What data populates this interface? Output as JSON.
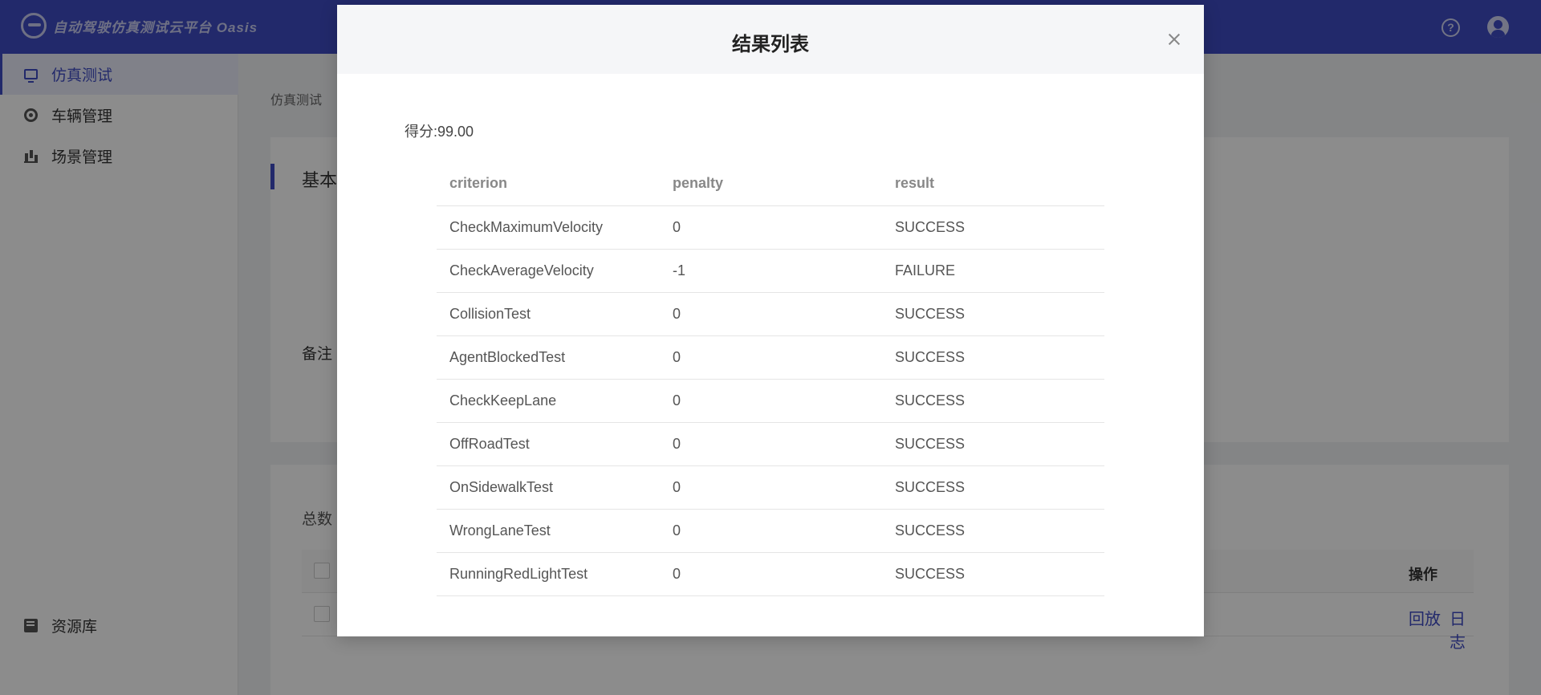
{
  "app": {
    "title": "自动驾驶仿真测试云平台 Oasis"
  },
  "sidebar": {
    "items": [
      {
        "label": "仿真测试",
        "icon": "monitor-icon",
        "active": true
      },
      {
        "label": "车辆管理",
        "icon": "wheel-icon",
        "active": false
      },
      {
        "label": "场景管理",
        "icon": "bars-icon",
        "active": false
      },
      {
        "label": "资源库",
        "icon": "book-icon",
        "active": false
      }
    ]
  },
  "page": {
    "breadcrumb": "仿真测试",
    "section_title": "基本",
    "remark_label": "备注",
    "total_label": "总数",
    "table": {
      "operation_header": "操作",
      "row_actions": [
        "回放",
        "日志"
      ]
    }
  },
  "modal": {
    "title": "结果列表",
    "score_label": "得分:",
    "score_value": "99.00",
    "columns": [
      "criterion",
      "penalty",
      "result"
    ],
    "rows": [
      {
        "criterion": "CheckMaximumVelocity",
        "penalty": "0",
        "result": "SUCCESS"
      },
      {
        "criterion": "CheckAverageVelocity",
        "penalty": "-1",
        "result": "FAILURE"
      },
      {
        "criterion": "CollisionTest",
        "penalty": "0",
        "result": "SUCCESS"
      },
      {
        "criterion": "AgentBlockedTest",
        "penalty": "0",
        "result": "SUCCESS"
      },
      {
        "criterion": "CheckKeepLane",
        "penalty": "0",
        "result": "SUCCESS"
      },
      {
        "criterion": "OffRoadTest",
        "penalty": "0",
        "result": "SUCCESS"
      },
      {
        "criterion": "OnSidewalkTest",
        "penalty": "0",
        "result": "SUCCESS"
      },
      {
        "criterion": "WrongLaneTest",
        "penalty": "0",
        "result": "SUCCESS"
      },
      {
        "criterion": "RunningRedLightTest",
        "penalty": "0",
        "result": "SUCCESS"
      }
    ]
  },
  "colors": {
    "brand": "#3f4bc4",
    "overlay": "rgba(0,0,0,0.45)"
  }
}
